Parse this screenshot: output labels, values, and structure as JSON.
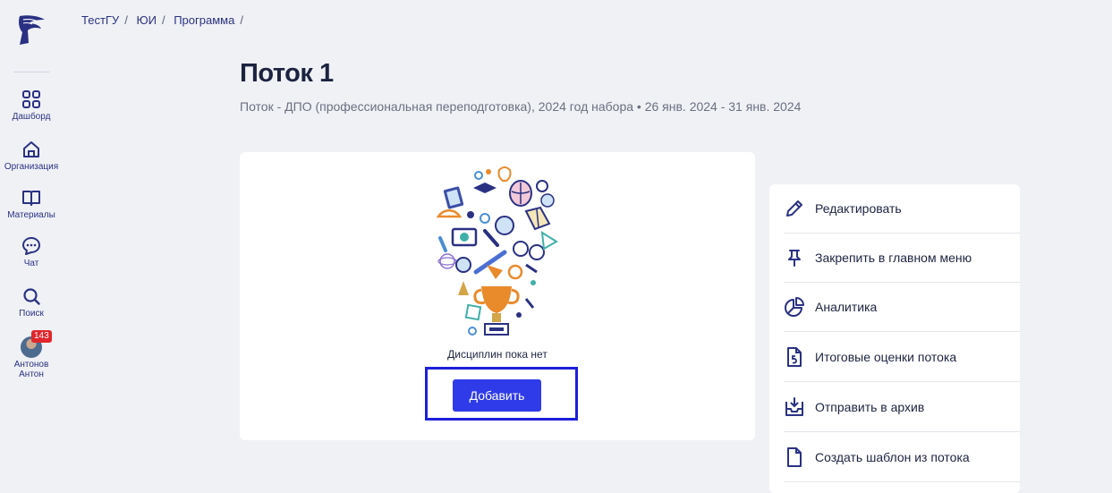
{
  "sidebar": {
    "items": [
      {
        "label": "Дашборд",
        "icon": "dashboard-grid-icon"
      },
      {
        "label": "Организация",
        "icon": "home-icon"
      },
      {
        "label": "Материалы",
        "icon": "book-icon"
      },
      {
        "label": "Чат",
        "icon": "chat-icon"
      },
      {
        "label": "Поиск",
        "icon": "search-icon"
      }
    ],
    "user": {
      "name": "Антонов\nАнтон",
      "badge": "143"
    }
  },
  "breadcrumb": [
    "ТестГУ",
    "ЮИ",
    "Программа"
  ],
  "breadcrumb_separator": "/",
  "page": {
    "title": "Поток 1",
    "subtitle": "Поток - ДПО (профессиональная переподготовка), 2024 год набора • 26 янв. 2024 - 31 янв. 2024"
  },
  "empty_state": {
    "text": "Дисциплин пока нет",
    "add_label": "Добавить"
  },
  "actions": [
    {
      "label": "Редактировать",
      "icon": "pencil-icon"
    },
    {
      "label": "Закрепить в главном меню",
      "icon": "pin-icon"
    },
    {
      "label": "Аналитика",
      "icon": "pie-chart-icon"
    },
    {
      "label": "Итоговые оценки потока",
      "icon": "grade-document-icon"
    },
    {
      "label": "Отправить в архив",
      "icon": "archive-tray-icon"
    },
    {
      "label": "Создать шаблон из потока",
      "icon": "document-icon"
    }
  ],
  "colors": {
    "accent": "#2f3be8",
    "nav": "#2a3183",
    "badge": "#e0262c",
    "background": "#eff1f5"
  }
}
